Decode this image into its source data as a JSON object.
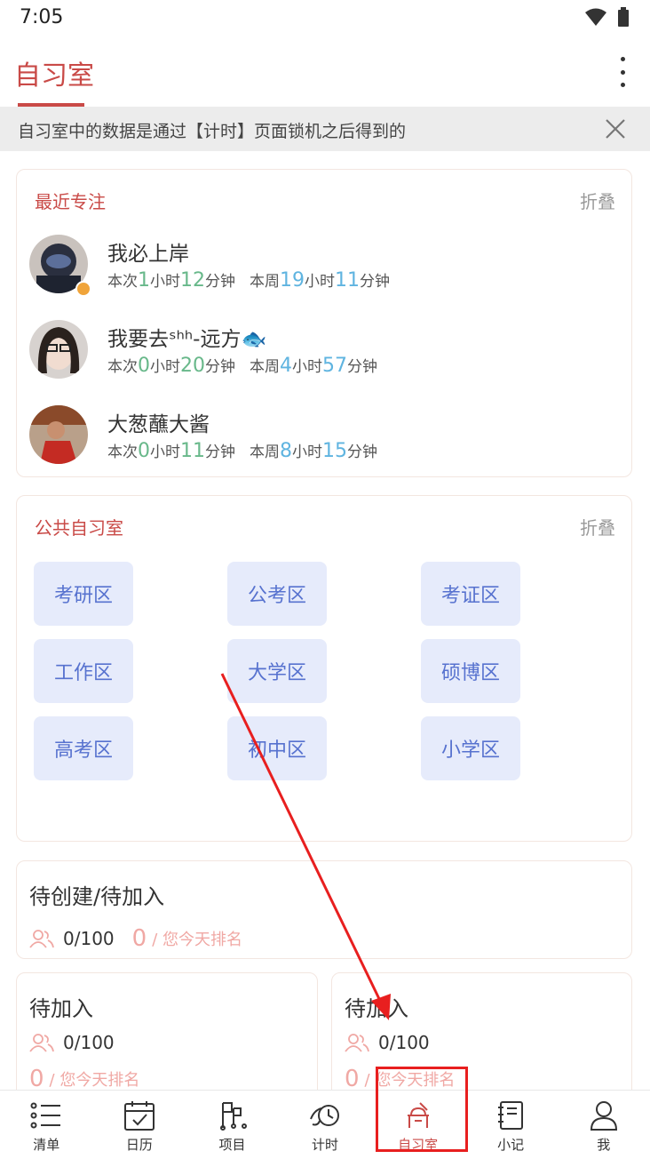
{
  "status": {
    "time": "7:05"
  },
  "app": {
    "title": "自习室"
  },
  "notice": {
    "text": "自习室中的数据是通过【计时】页面锁机之后得到的"
  },
  "recent": {
    "title": "最近专注",
    "fold": "折叠",
    "labels": {
      "this": "本次",
      "week": "本周",
      "hour": "小时",
      "minute": "分钟"
    },
    "items": [
      {
        "name": "我必上岸",
        "this_h": "1",
        "this_m": "12",
        "week_h": "19",
        "week_m": "11"
      },
      {
        "name": "我要去ˢʰʰ-远方🐟",
        "this_h": "0",
        "this_m": "20",
        "week_h": "4",
        "week_m": "57"
      },
      {
        "name": "大葱蘸大酱",
        "this_h": "0",
        "this_m": "11",
        "week_h": "8",
        "week_m": "15"
      }
    ]
  },
  "public": {
    "title": "公共自习室",
    "fold": "折叠",
    "zones": [
      "考研区",
      "公考区",
      "考证区",
      "工作区",
      "大学区",
      "硕博区",
      "高考区",
      "初中区",
      "小学区"
    ]
  },
  "rooms": [
    {
      "title": "待创建/待加入",
      "count": "0/100",
      "rank": "0",
      "rank_label": "/ 您今天排名"
    },
    {
      "title": "待加入",
      "count": "0/100",
      "rank": "0",
      "rank_label": "/ 您今天排名"
    },
    {
      "title": "待加入",
      "count": "0/100",
      "rank": "0",
      "rank_label": "/ 您今天排名"
    }
  ],
  "nav": [
    "清单",
    "日历",
    "项目",
    "计时",
    "自习室",
    "小记",
    "我"
  ],
  "colors": {
    "accent": "#c94a47",
    "zone_bg": "#e6ebfb",
    "zone_text": "#5772cf",
    "annotation": "#e81f1f"
  }
}
